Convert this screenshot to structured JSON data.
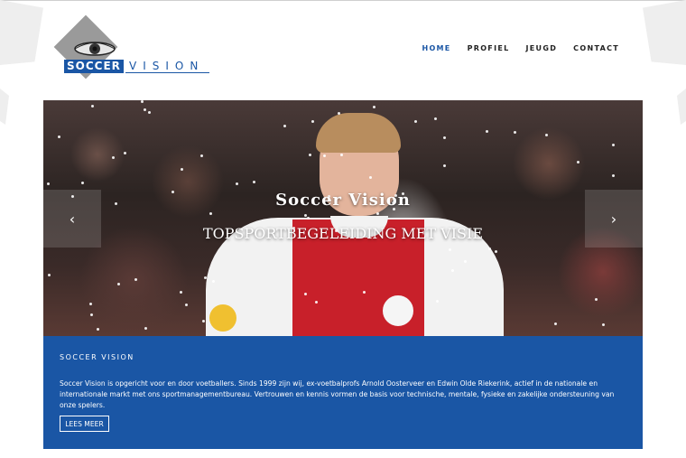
{
  "brand": {
    "logo_word_1": "SOCCER",
    "logo_word_2": "VISION",
    "colors": {
      "accent": "#1a56a5",
      "grey": "#9a9a9a"
    }
  },
  "nav": {
    "items": [
      {
        "label": "HOME",
        "active": true
      },
      {
        "label": "PROFIEL",
        "active": false
      },
      {
        "label": "JEUGD",
        "active": false
      },
      {
        "label": "CONTACT",
        "active": false
      }
    ]
  },
  "hero": {
    "title": "Soccer Vision",
    "subtitle": "TOPSPORTBEGELEIDING MET VISIE",
    "prev_icon": "chevron-left-icon",
    "next_icon": "chevron-right-icon",
    "prev_glyph": "‹",
    "next_glyph": "›"
  },
  "info": {
    "title": "SOCCER VISION",
    "text": "Soccer Vision is opgericht voor en door voetballers. Sinds 1999 zijn wij, ex-voetbalprofs Arnold Oosterveer en Edwin Olde Riekerink, actief in de nationale en internationale markt met ons sportmanagementbureau. Vertrouwen en kennis vormen de basis voor technische, mentale, fysieke en zakelijke ondersteuning van onze spelers.",
    "button_label": "LEES MEER"
  }
}
